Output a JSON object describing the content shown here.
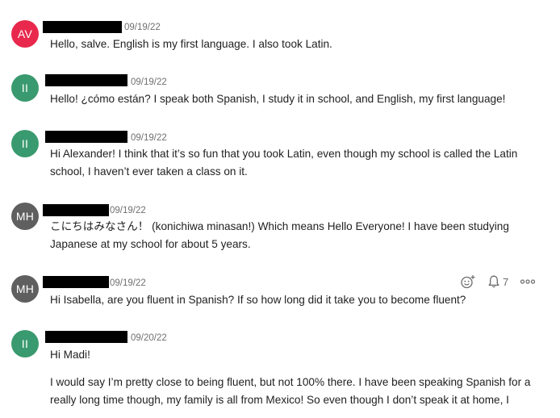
{
  "colors": {
    "avatar_av": "#e8294d",
    "avatar_ii": "#3a9a6f",
    "avatar_mh": "#5f5f5f"
  },
  "posts": [
    {
      "initials": "AV",
      "author_redacted": true,
      "date": "09/19/22",
      "paragraphs": [
        "Hello, salve. English is my first language. I also took Latin."
      ]
    },
    {
      "initials": "II",
      "author_redacted": true,
      "date": "09/19/22",
      "paragraphs": [
        "Hello! ¿cómo están? I speak both Spanish, I study it in school, and English, my first language!"
      ]
    },
    {
      "initials": "II",
      "author_redacted": true,
      "date": "09/19/22",
      "paragraphs": [
        "Hi Alexander! I think that it’s so fun that you took Latin, even though my school is called the Latin school, I haven’t ever taken a class on it."
      ]
    },
    {
      "initials": "MH",
      "author_redacted": true,
      "date": "09/19/22",
      "paragraphs": [
        "こにちはみなさん！ (konichiwa minasan!) Which means Hello Everyone! I have been studying Japanese at my school for about 5 years."
      ]
    },
    {
      "initials": "MH",
      "author_redacted": true,
      "date": "09/19/22",
      "paragraphs": [
        "Hi Isabella, are you fluent in Spanish? If so how long did it take you to become fluent?"
      ],
      "actions": {
        "reaction_icon": "add-reaction-icon",
        "notification_icon": "bell-icon",
        "notification_count": "7",
        "more_icon": "more-options-icon"
      }
    },
    {
      "initials": "II",
      "author_redacted": true,
      "date": "09/20/22",
      "paragraphs": [
        "Hi Madi!",
        "I would say I’m pretty close to being fluent, but not 100% there. I have been speaking Spanish for a really long time though, my family is all from Mexico! So even though I don’t speak it at home, I"
      ]
    }
  ]
}
